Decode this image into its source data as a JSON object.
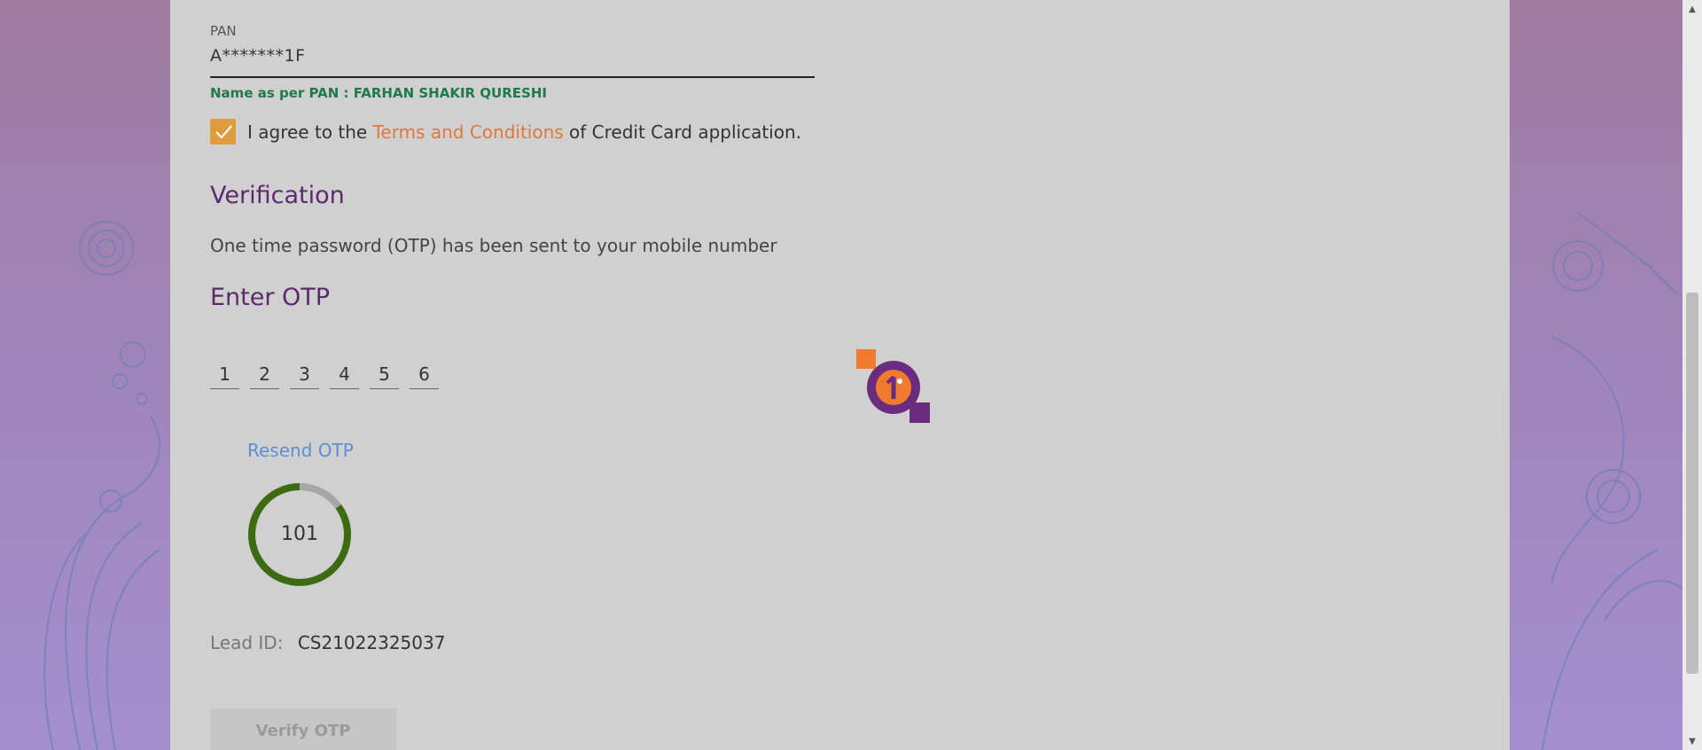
{
  "pan": {
    "label": "PAN",
    "value": "A*******1F",
    "name_line": "Name as per PAN : FARHAN SHAKIR QURESHI"
  },
  "agreement": {
    "prefix": "I agree to the ",
    "link": "Terms and Conditions",
    "suffix": " of Credit Card application.",
    "checked": true
  },
  "verification": {
    "heading": "Verification",
    "info": "One time password (OTP) has been sent to your mobile number"
  },
  "otp": {
    "heading": "Enter OTP",
    "digits": [
      "1",
      "2",
      "3",
      "4",
      "5",
      "6"
    ],
    "resend_label": "Resend OTP",
    "timer_value": "101",
    "timer_fraction_remaining": 0.85
  },
  "lead": {
    "label": "Lead ID:",
    "value": "CS21022325037"
  },
  "actions": {
    "verify_label": "Verify OTP"
  },
  "colors": {
    "accent_purple": "#5b2a6e",
    "accent_orange": "#e0773c",
    "checkbox": "#e09b3d",
    "pan_name": "#1e7a4a",
    "timer_ring": "#3d6b12",
    "link_blue": "#5a8fd8"
  },
  "icons": {
    "loader": "loader-spinner-icon",
    "check": "checkmark-icon"
  }
}
